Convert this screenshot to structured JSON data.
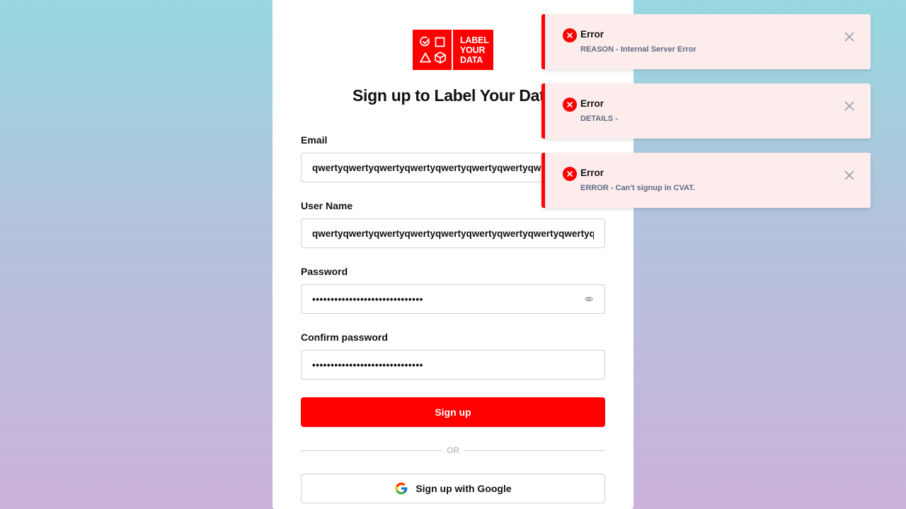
{
  "brand": {
    "logo_lines": [
      "LABEL",
      "YOUR",
      "DATA"
    ],
    "accent_color": "#ff0000"
  },
  "form": {
    "title": "Sign up to Label Your Data",
    "email": {
      "label": "Email",
      "value": "qwertyqwertyqwertyqwertyqwertyqwertyqwertyqwertyq@g"
    },
    "username": {
      "label": "User Name",
      "value": "qwertyqwertyqwertyqwertyqwertyqwertyqwertyqwertyqwertyqwertyqwe"
    },
    "password": {
      "label": "Password",
      "value": "••••••••••••••••••••••••••••••",
      "toggle_icon": "eye-icon"
    },
    "confirm_password": {
      "label": "Confirm password",
      "value": "••••••••••••••••••••••••••••••"
    },
    "submit_label": "Sign up",
    "divider_text": "OR",
    "google_label": "Sign up with Google"
  },
  "notifications": [
    {
      "title": "Error",
      "message": "REASON - Internal Server Error",
      "icon": "error-icon"
    },
    {
      "title": "Error",
      "message": "DETAILS -",
      "icon": "error-icon"
    },
    {
      "title": "Error",
      "message": "ERROR - Can't signup in CVAT.",
      "icon": "error-icon"
    }
  ]
}
